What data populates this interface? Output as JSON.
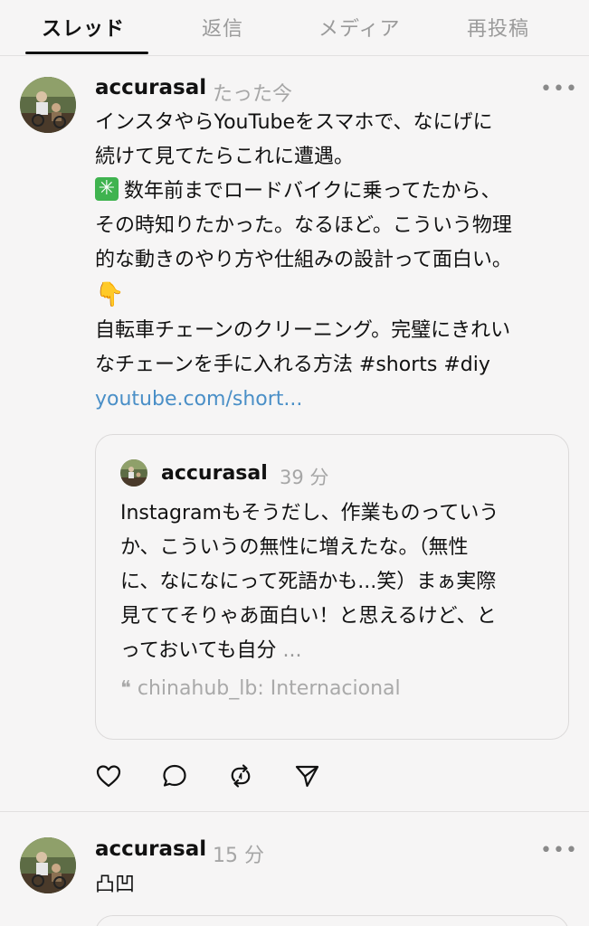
{
  "tabs": [
    {
      "label": "スレッド",
      "active": true
    },
    {
      "label": "返信",
      "active": false
    },
    {
      "label": "メディア",
      "active": false
    },
    {
      "label": "再投稿",
      "active": false
    }
  ],
  "post1": {
    "username": "accurasal",
    "time": "たった今",
    "more": "•••",
    "lines": [
      "インスタやらYouTubeをスマホで、なにげに",
      "続けて見てたらこれに遭遇。",
      "数年前までロードバイクに乗ってたから、",
      "その時知りたかった。なるほど。こういう物理",
      "的な動きのやり方や仕組みの設計って面白い。",
      "自転車チェーンのクリーニング。完璧にきれい",
      "なチェーンを手に入れる方法 #shorts #diy"
    ],
    "emoji_icon": "eight-spoked-asterisk-emoji",
    "hand_icon": "backhand-index-pointing-down-emoji",
    "hand_glyph": "👇",
    "link": "youtube.com/short...",
    "quote": {
      "username": "accurasal",
      "time": "39 分",
      "lines": [
        "Instagramもそうだし、作業ものっていう",
        "か、こういうの無性に増えたな。（無性",
        "に、なになにって死語かも...笑）まぁ実際",
        "見ててそりゃあ面白い！と思えるけど、と",
        "っておいても自分"
      ],
      "ellipsis": "...",
      "source_mark": "❝",
      "source": "chinahub_lb: Internacional"
    },
    "actions": [
      "heart-icon",
      "comment-icon",
      "repost-icon",
      "share-icon"
    ]
  },
  "post2": {
    "username": "accurasal",
    "time": "15 分",
    "more": "•••",
    "text": "凸凹"
  },
  "colors": {
    "background": "#f6f5f5",
    "link": "#4a8fc7",
    "muted": "#a6a6a6",
    "emoji_green": "#3fb34f"
  }
}
